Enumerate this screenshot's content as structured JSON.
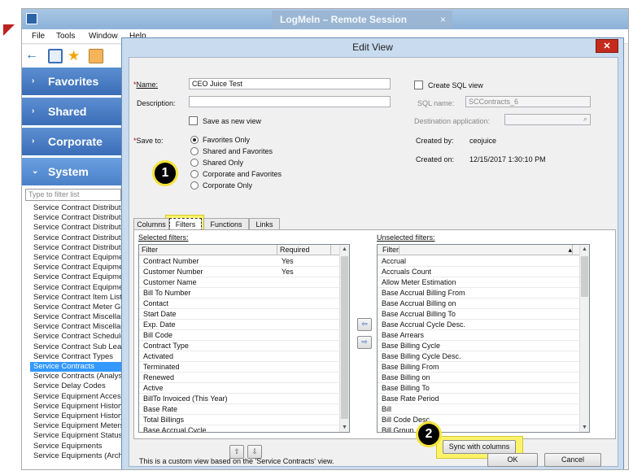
{
  "app": {
    "logmein_title": "LogMeIn – Remote Session",
    "logmein_close": "×",
    "menu": [
      "File",
      "Tools",
      "Window",
      "Help"
    ]
  },
  "nav": {
    "sections": [
      {
        "label": "Favorites",
        "arrow": "›"
      },
      {
        "label": "Shared",
        "arrow": "›"
      },
      {
        "label": "Corporate",
        "arrow": "›"
      },
      {
        "label": "System",
        "arrow": "⌄"
      }
    ],
    "filter_placeholder": "Type to filter list",
    "items": [
      "Service Contract Distribution",
      "Service Contract Distribution",
      "Service Contract Distribution",
      "Service Contract Distribution",
      "Service Contract Distribution",
      "Service Contract Equipment",
      "Service Contract Equipment",
      "Service Contract Equipment",
      "Service Contract Equipment",
      "Service Contract Item List",
      "Service Contract Meter Group",
      "Service Contract Miscellaneous",
      "Service Contract Miscellaneous",
      "Service Contract Schedule",
      "Service Contract Sub Lease",
      "Service Contract Types",
      "Service Contracts",
      "Service Contracts (Analysis)",
      "Service Delay Codes",
      "Service Equipment Accessories",
      "Service Equipment History",
      "Service Equipment History",
      "Service Equipment Meters",
      "Service Equipment Status",
      "Service Equipments",
      "Service Equipments (Archive)"
    ],
    "selected_index": 16
  },
  "dialog": {
    "title": "Edit View",
    "close": "✕",
    "name_label": "Name:",
    "name_value": "CEO Juice Test",
    "description_label": "Description:",
    "description_value": "",
    "save_as_new": "Save as new view",
    "save_to_label": "Save to:",
    "save_to_options": [
      "Favorites Only",
      "Shared and Favorites",
      "Shared Only",
      "Corporate and Favorites",
      "Corporate Only"
    ],
    "create_sql": "Create SQL view",
    "sql_name_label": "SQL name:",
    "sql_name_value": "SCContracts_6",
    "dest_label": "Destination application:",
    "created_by_label": "Created by:",
    "created_by_value": "ceojuice",
    "created_on_label": "Created on:",
    "created_on_value": "12/15/2017 1:30:10 PM",
    "tabs": [
      "Columns",
      "Filters",
      "Functions",
      "Links"
    ],
    "active_tab": 1,
    "selected_filters_label": "Selected filters:",
    "unselected_filters_label": "Unselected filters:",
    "selected_headers": [
      "Filter",
      "Required"
    ],
    "selected_rows": [
      [
        "Contract Number",
        "Yes"
      ],
      [
        "Customer Number",
        "Yes"
      ],
      [
        "Customer Name",
        ""
      ],
      [
        "Bill To Number",
        ""
      ],
      [
        "Contact",
        ""
      ],
      [
        "Start Date",
        ""
      ],
      [
        "Exp. Date",
        ""
      ],
      [
        "Bill Code",
        ""
      ],
      [
        "Contract Type",
        ""
      ],
      [
        "Activated",
        ""
      ],
      [
        "Terminated",
        ""
      ],
      [
        "Renewed",
        ""
      ],
      [
        "Active",
        ""
      ],
      [
        "BillTo Invoiced (This Year)",
        ""
      ],
      [
        "Base Rate",
        ""
      ],
      [
        "Total Billings",
        ""
      ],
      [
        "Base Accrual Cycle",
        ""
      ]
    ],
    "unselected_header": "Filter",
    "unselected_rows": [
      "Accrual",
      "Accruals Count",
      "Allow Meter Estimation",
      "Base Accrual Billing From",
      "Base Accrual Billing on",
      "Base Accrual Billing To",
      "Base Accrual Cycle Desc.",
      "Base Arrears",
      "Base Billing Cycle",
      "Base Billing Cycle Desc.",
      "Base Billing From",
      "Base Billing on",
      "Base Billing To",
      "Base Rate Period",
      "Bill",
      "Bill Code Desc.",
      "Bill Group"
    ],
    "sync_button": "Sync with columns",
    "footer_text": "This is a custom view based on the 'Service Contracts' view.",
    "ok": "OK",
    "cancel": "Cancel"
  },
  "callouts": [
    "1",
    "2"
  ]
}
